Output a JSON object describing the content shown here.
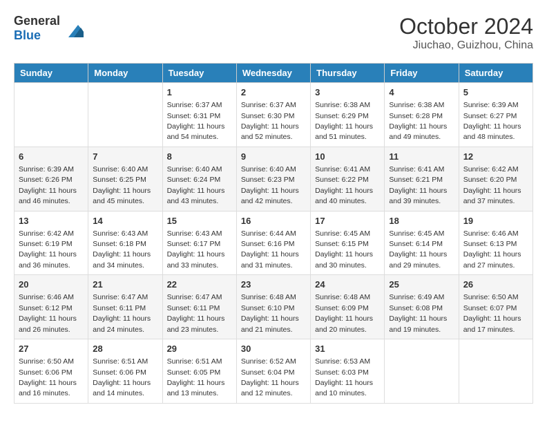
{
  "header": {
    "logo_general": "General",
    "logo_blue": "Blue",
    "title": "October 2024",
    "subtitle": "Jiuchao, Guizhou, China"
  },
  "calendar": {
    "days_of_week": [
      "Sunday",
      "Monday",
      "Tuesday",
      "Wednesday",
      "Thursday",
      "Friday",
      "Saturday"
    ],
    "weeks": [
      [
        {
          "day": "",
          "info": ""
        },
        {
          "day": "",
          "info": ""
        },
        {
          "day": "1",
          "info": "Sunrise: 6:37 AM\nSunset: 6:31 PM\nDaylight: 11 hours and 54 minutes."
        },
        {
          "day": "2",
          "info": "Sunrise: 6:37 AM\nSunset: 6:30 PM\nDaylight: 11 hours and 52 minutes."
        },
        {
          "day": "3",
          "info": "Sunrise: 6:38 AM\nSunset: 6:29 PM\nDaylight: 11 hours and 51 minutes."
        },
        {
          "day": "4",
          "info": "Sunrise: 6:38 AM\nSunset: 6:28 PM\nDaylight: 11 hours and 49 minutes."
        },
        {
          "day": "5",
          "info": "Sunrise: 6:39 AM\nSunset: 6:27 PM\nDaylight: 11 hours and 48 minutes."
        }
      ],
      [
        {
          "day": "6",
          "info": "Sunrise: 6:39 AM\nSunset: 6:26 PM\nDaylight: 11 hours and 46 minutes."
        },
        {
          "day": "7",
          "info": "Sunrise: 6:40 AM\nSunset: 6:25 PM\nDaylight: 11 hours and 45 minutes."
        },
        {
          "day": "8",
          "info": "Sunrise: 6:40 AM\nSunset: 6:24 PM\nDaylight: 11 hours and 43 minutes."
        },
        {
          "day": "9",
          "info": "Sunrise: 6:40 AM\nSunset: 6:23 PM\nDaylight: 11 hours and 42 minutes."
        },
        {
          "day": "10",
          "info": "Sunrise: 6:41 AM\nSunset: 6:22 PM\nDaylight: 11 hours and 40 minutes."
        },
        {
          "day": "11",
          "info": "Sunrise: 6:41 AM\nSunset: 6:21 PM\nDaylight: 11 hours and 39 minutes."
        },
        {
          "day": "12",
          "info": "Sunrise: 6:42 AM\nSunset: 6:20 PM\nDaylight: 11 hours and 37 minutes."
        }
      ],
      [
        {
          "day": "13",
          "info": "Sunrise: 6:42 AM\nSunset: 6:19 PM\nDaylight: 11 hours and 36 minutes."
        },
        {
          "day": "14",
          "info": "Sunrise: 6:43 AM\nSunset: 6:18 PM\nDaylight: 11 hours and 34 minutes."
        },
        {
          "day": "15",
          "info": "Sunrise: 6:43 AM\nSunset: 6:17 PM\nDaylight: 11 hours and 33 minutes."
        },
        {
          "day": "16",
          "info": "Sunrise: 6:44 AM\nSunset: 6:16 PM\nDaylight: 11 hours and 31 minutes."
        },
        {
          "day": "17",
          "info": "Sunrise: 6:45 AM\nSunset: 6:15 PM\nDaylight: 11 hours and 30 minutes."
        },
        {
          "day": "18",
          "info": "Sunrise: 6:45 AM\nSunset: 6:14 PM\nDaylight: 11 hours and 29 minutes."
        },
        {
          "day": "19",
          "info": "Sunrise: 6:46 AM\nSunset: 6:13 PM\nDaylight: 11 hours and 27 minutes."
        }
      ],
      [
        {
          "day": "20",
          "info": "Sunrise: 6:46 AM\nSunset: 6:12 PM\nDaylight: 11 hours and 26 minutes."
        },
        {
          "day": "21",
          "info": "Sunrise: 6:47 AM\nSunset: 6:11 PM\nDaylight: 11 hours and 24 minutes."
        },
        {
          "day": "22",
          "info": "Sunrise: 6:47 AM\nSunset: 6:11 PM\nDaylight: 11 hours and 23 minutes."
        },
        {
          "day": "23",
          "info": "Sunrise: 6:48 AM\nSunset: 6:10 PM\nDaylight: 11 hours and 21 minutes."
        },
        {
          "day": "24",
          "info": "Sunrise: 6:48 AM\nSunset: 6:09 PM\nDaylight: 11 hours and 20 minutes."
        },
        {
          "day": "25",
          "info": "Sunrise: 6:49 AM\nSunset: 6:08 PM\nDaylight: 11 hours and 19 minutes."
        },
        {
          "day": "26",
          "info": "Sunrise: 6:50 AM\nSunset: 6:07 PM\nDaylight: 11 hours and 17 minutes."
        }
      ],
      [
        {
          "day": "27",
          "info": "Sunrise: 6:50 AM\nSunset: 6:06 PM\nDaylight: 11 hours and 16 minutes."
        },
        {
          "day": "28",
          "info": "Sunrise: 6:51 AM\nSunset: 6:06 PM\nDaylight: 11 hours and 14 minutes."
        },
        {
          "day": "29",
          "info": "Sunrise: 6:51 AM\nSunset: 6:05 PM\nDaylight: 11 hours and 13 minutes."
        },
        {
          "day": "30",
          "info": "Sunrise: 6:52 AM\nSunset: 6:04 PM\nDaylight: 11 hours and 12 minutes."
        },
        {
          "day": "31",
          "info": "Sunrise: 6:53 AM\nSunset: 6:03 PM\nDaylight: 11 hours and 10 minutes."
        },
        {
          "day": "",
          "info": ""
        },
        {
          "day": "",
          "info": ""
        }
      ]
    ]
  }
}
